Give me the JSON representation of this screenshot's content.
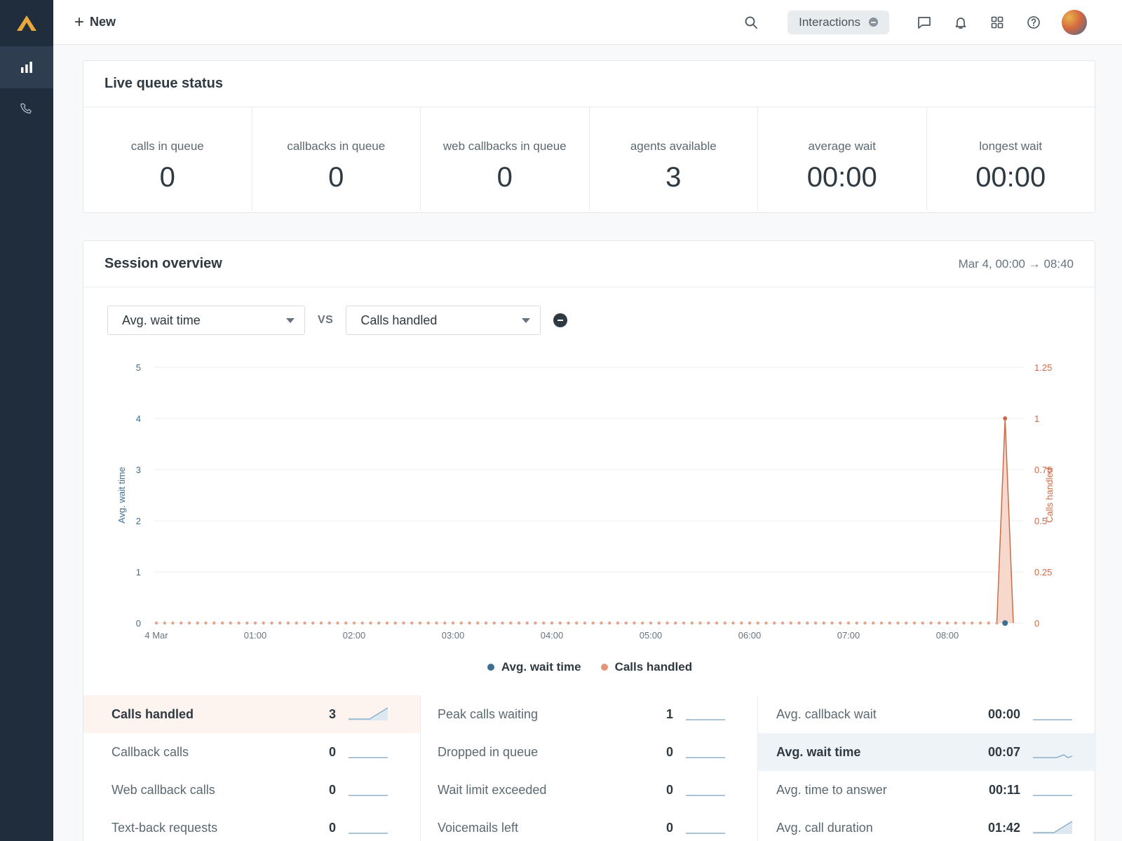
{
  "topbar": {
    "new_label": "New",
    "interactions_label": "Interactions"
  },
  "live_queue": {
    "title": "Live queue status",
    "stats": [
      {
        "label": "calls in queue",
        "value": "0"
      },
      {
        "label": "callbacks in queue",
        "value": "0"
      },
      {
        "label": "web callbacks in queue",
        "value": "0"
      },
      {
        "label": "agents available",
        "value": "3"
      },
      {
        "label": "average wait",
        "value": "00:00"
      },
      {
        "label": "longest wait",
        "value": "00:00"
      }
    ]
  },
  "session": {
    "title": "Session overview",
    "range": "Mar 4, 00:00 → 08:40",
    "metric_a": "Avg. wait time",
    "vs_label": "VS",
    "metric_b": "Calls handled"
  },
  "chart_data": {
    "type": "line",
    "x_ticks": [
      "4 Mar",
      "01:00",
      "02:00",
      "03:00",
      "04:00",
      "05:00",
      "06:00",
      "07:00",
      "08:00"
    ],
    "x_range_minutes": [
      0,
      520
    ],
    "left_axis": {
      "label": "Avg. wait time",
      "ticks": [
        "0",
        "1",
        "2",
        "3",
        "4",
        "5"
      ],
      "range": [
        0,
        5
      ],
      "color": "#3d6f93"
    },
    "right_axis": {
      "label": "Calls handled",
      "ticks": [
        "0",
        "0.25",
        "0.5",
        "0.75",
        "1",
        "1.25"
      ],
      "range": [
        0,
        1.25
      ],
      "color": "#c96c4a"
    },
    "series": [
      {
        "name": "Avg. wait time",
        "axis": "left",
        "color": "#3d6f93",
        "points": [
          [
            515,
            0
          ]
        ]
      },
      {
        "name": "Calls handled",
        "axis": "right",
        "color": "#c96c4a",
        "interval_minutes": 5,
        "spike_at": 515,
        "spike_value": 1
      }
    ],
    "legend_position": "bottom",
    "grid": true
  },
  "metrics": {
    "col1": [
      {
        "label": "Calls handled",
        "value": "3"
      },
      {
        "label": "Callback calls",
        "value": "0"
      },
      {
        "label": "Web callback calls",
        "value": "0"
      },
      {
        "label": "Text-back requests",
        "value": "0"
      }
    ],
    "col2": [
      {
        "label": "Peak calls waiting",
        "value": "1"
      },
      {
        "label": "Dropped in queue",
        "value": "0"
      },
      {
        "label": "Wait limit exceeded",
        "value": "0"
      },
      {
        "label": "Voicemails left",
        "value": "0"
      }
    ],
    "col3": [
      {
        "label": "Avg. callback wait",
        "value": "00:00"
      },
      {
        "label": "Avg. wait time",
        "value": "00:07"
      },
      {
        "label": "Avg. time to answer",
        "value": "00:11"
      },
      {
        "label": "Avg. call duration",
        "value": "01:42"
      }
    ]
  }
}
